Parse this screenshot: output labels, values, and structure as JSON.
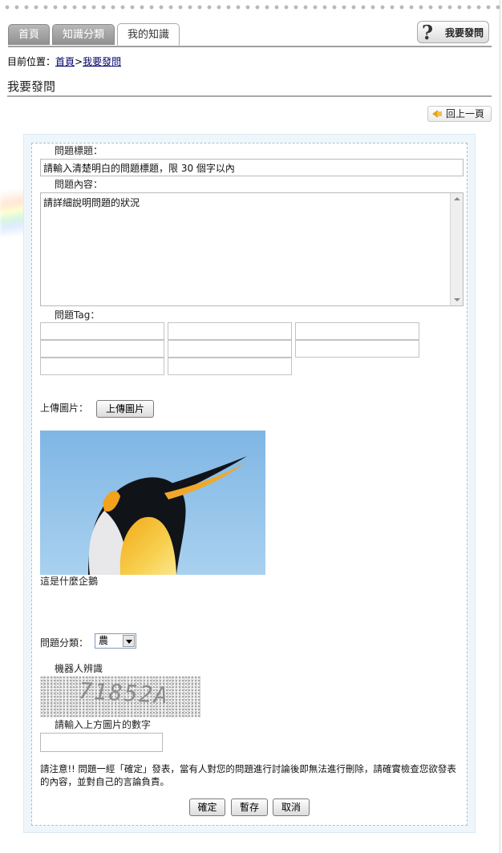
{
  "nav": {
    "tabs": [
      {
        "label": "首頁",
        "active": false
      },
      {
        "label": "知識分類",
        "active": false
      },
      {
        "label": "我的知識",
        "active": true
      }
    ],
    "ask_button": "我要發問",
    "ask_icon": "?"
  },
  "breadcrumb": {
    "prefix": "目前位置：",
    "home": "首頁",
    "separator": ">",
    "current": "我要發問"
  },
  "page_title": "我要發問",
  "back_button": "回上一頁",
  "form": {
    "title_label": "問題標題：",
    "title_value": "請輸入清楚明白的問題標題，限 30 個字以內",
    "content_label": "問題內容：",
    "content_value": "請詳細說明問題的狀況",
    "tag_label": "問題Tag：",
    "upload_label": "上傳圖片：",
    "upload_button": "上傳圖片",
    "image_caption": "這是什麼企鵝",
    "category_label": "問題分類：",
    "category_value": "農",
    "captcha_label": "機器人辨識",
    "captcha_text": "71852A",
    "captcha_input_label": "請輸入上方圖片的數字",
    "notice": "請注意!! 問題一經「確定」發表，當有人對您的問題進行討論後即無法進行刪除，請確實檢查您欲發表的內容，並對自己的言論負責。",
    "buttons": {
      "confirm": "確定",
      "draft": "暫存",
      "cancel": "取消"
    }
  },
  "colors": {
    "tab_bg": "#9e9e9e",
    "panel_bg": "#eef6fb",
    "panel_border": "#9bc6d6",
    "link": "#000066"
  }
}
